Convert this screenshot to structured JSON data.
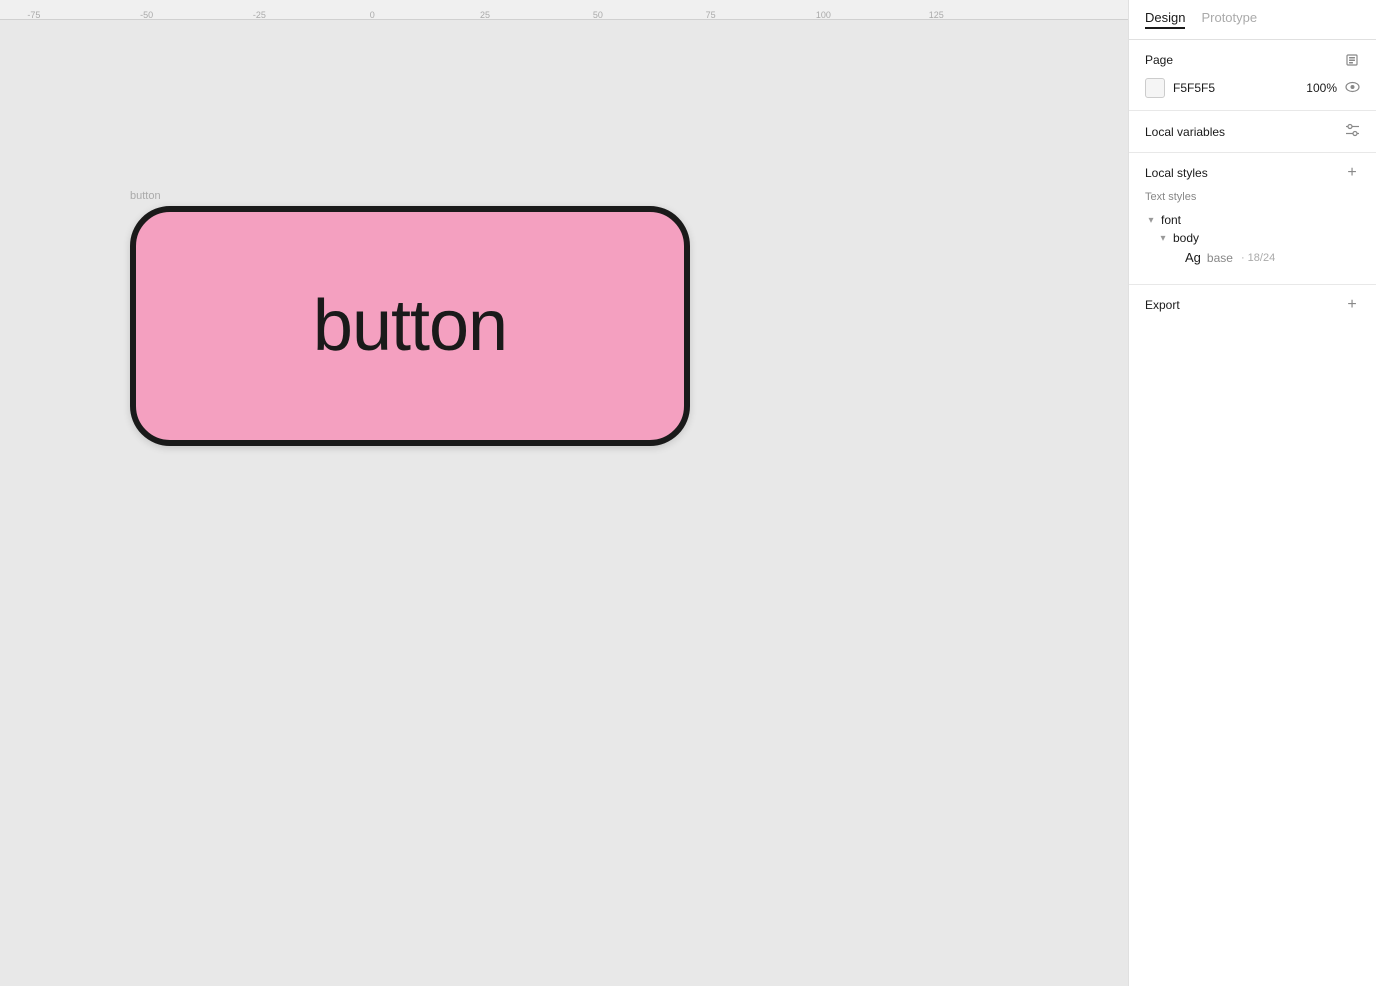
{
  "canvas": {
    "background_color": "#e8e8e8",
    "ruler_ticks": [
      {
        "label": "-75",
        "position_percent": 3
      },
      {
        "label": "-50",
        "position_percent": 13
      },
      {
        "label": "-25",
        "position_percent": 23
      },
      {
        "label": "0",
        "position_percent": 33
      },
      {
        "label": "25",
        "position_percent": 43
      },
      {
        "label": "50",
        "position_percent": 53
      },
      {
        "label": "75",
        "position_percent": 63
      },
      {
        "label": "100",
        "position_percent": 73
      },
      {
        "label": "125",
        "position_percent": 83
      }
    ],
    "frame": {
      "label": "button",
      "text": "button",
      "background_color": "#f4a0c0",
      "border_color": "#1a1a1a",
      "border_radius": "40px",
      "border_width": "6px"
    }
  },
  "right_panel": {
    "tabs": [
      {
        "label": "Design",
        "active": true
      },
      {
        "label": "Prototype",
        "active": false
      }
    ],
    "page_section": {
      "title": "Page",
      "color_value": "F5F5F5",
      "zoom_value": "100%"
    },
    "local_variables": {
      "title": "Local variables"
    },
    "local_styles": {
      "title": "Local styles",
      "text_styles_title": "Text styles",
      "groups": [
        {
          "name": "font",
          "children": [
            {
              "name": "body",
              "items": [
                {
                  "preview": "Ag",
                  "name": "base",
                  "details": "18/24"
                }
              ]
            }
          ]
        }
      ]
    },
    "export_section": {
      "title": "Export"
    }
  }
}
